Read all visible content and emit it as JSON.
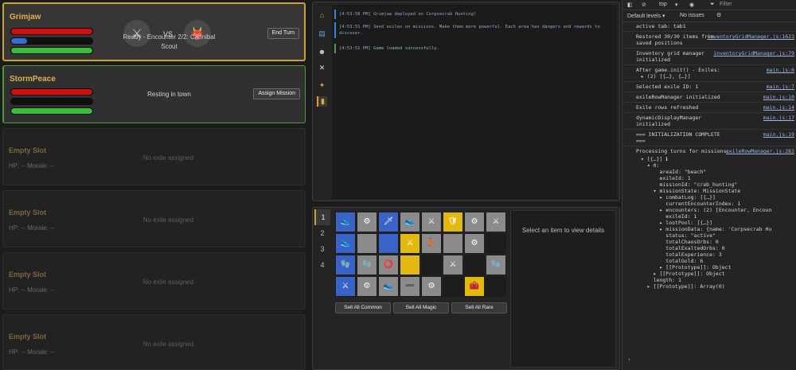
{
  "exiles": {
    "grimjaw": {
      "name": "Grimjaw",
      "status": "Ready - Encounter 2/2: Cannibal Scout",
      "vs": "VS",
      "action": "End Turn",
      "hp": 1.0,
      "xp": 0.2,
      "morale": 1.0,
      "player_icon": "⚔",
      "enemy_icon": "👹"
    },
    "stormpeace": {
      "name": "StormPeace",
      "status": "Resting in town",
      "action": "Assign Mission",
      "hp": 1.0,
      "xp": 0.0,
      "morale": 1.0
    },
    "empty_slots": [
      {
        "name": "Empty Slot",
        "stats": "HP: -- Morale: --",
        "message": "No exile assigned"
      },
      {
        "name": "Empty Slot",
        "stats": "HP: -- Morale: --",
        "message": "No exile assigned"
      },
      {
        "name": "Empty Slot",
        "stats": "HP: -- Morale: --",
        "message": "No exile assigned"
      },
      {
        "name": "Empty Slot",
        "stats": "HP: -- Morale: --",
        "message": "No exile assigned"
      }
    ]
  },
  "sidebar_icons": [
    "home-icon",
    "book-icon",
    "character-icon",
    "swords-icon",
    "crafting-icon",
    "log-icon"
  ],
  "log": [
    {
      "time": "[4:53:58 PM]",
      "text": "Grimjaw deployed on Corpsecrab Hunting!",
      "kind": "info"
    },
    {
      "time": "[4:53:51 PM]",
      "text": "Send exiles on missions. Make them more powerful. Each area has dangers and rewards to discover.",
      "kind": "info"
    },
    {
      "time": "[4:53:51 PM]",
      "text": "Game loaded successfully.",
      "kind": "ok"
    }
  ],
  "inventory": {
    "tabs": [
      "1",
      "2",
      "3",
      "4"
    ],
    "selected_tab": "1",
    "cells": [
      [
        "m:👟",
        "n:⚙",
        "m:🗡",
        "n:👟",
        "n:⚔",
        "r:🛡",
        "n:⚙",
        "n:⚔"
      ],
      [
        "m:👟",
        "n:",
        "m:",
        "r:⚔",
        "n:👢",
        "n:",
        "n:⚙",
        "d:"
      ],
      [
        "m:🧤",
        "n:🧤",
        "n:⭕",
        "r:",
        "d:",
        "n:⚔",
        "d:",
        "n:🧤"
      ],
      [
        "m:⚔",
        "n:⚙",
        "n:👟",
        "n:➖",
        "n:⚙",
        "d:",
        "r:🧰",
        "d:"
      ]
    ],
    "sell_buttons": [
      "Sell All Common",
      "Sell All Magic",
      "Sell All Rare"
    ],
    "details_message": "Select an item to view details"
  },
  "devtools": {
    "context": "top",
    "filter_placeholder": "Filter",
    "levels": "Default levels ▾",
    "issues": "No issues",
    "messages": [
      {
        "text": "active tab: tab1",
        "src": ""
      },
      {
        "text": "Restored 30/30 items from saved positions",
        "src": "inventoryGridManager.js:1623"
      },
      {
        "text": "Inventory grid manager initialized",
        "src": "inventoryGridManager.js:79"
      },
      {
        "text": "After game.init() - Exiles:",
        "src": "main.js:6"
      },
      {
        "text": "Selected exile ID: 1",
        "src": "main.js:7"
      },
      {
        "text": "exileRowManager initialized",
        "src": "main.js:10"
      },
      {
        "text": "Exile rows refreshed",
        "src": "main.js:14"
      },
      {
        "text": "dynamicDisplayManager initialized",
        "src": "main.js:17"
      },
      {
        "text": "=== INITIALIZATION COMPLETE ===",
        "src": "main.js:19"
      },
      {
        "text": "Processing turns for missions:",
        "src": "exileRowManager.js:282"
      }
    ],
    "exiles_preview": "▸ (2) [{…}, {…}]",
    "tree": [
      "▾ [{…}] ℹ",
      "  ▾ 0:",
      "      areaId: \"beach\"",
      "      exileId: 1",
      "      missionId: \"crab_hunting\"",
      "    ▾ missionState: MissionState",
      "      ▸ combatLog: [{…}]",
      "        currentEncounterIndex: 1",
      "      ▸ encounters: (2) [Encounter, Encoun",
      "        exileId: 1",
      "      ▸ lootPool: [{…}]",
      "      ▸ missionData: {name: 'Corpsecrab Hu",
      "        status: \"active\"",
      "        totalChaosOrbs: 0",
      "        totalExaltedOrbs: 0",
      "        totalExperience: 3",
      "        totalGold: 6",
      "      ▸ [[Prototype]]: Object",
      "    ▸ [[Prototype]]: Object",
      "    length: 1",
      "  ▸ [[Prototype]]: Array(0)"
    ],
    "prompt": "›"
  }
}
